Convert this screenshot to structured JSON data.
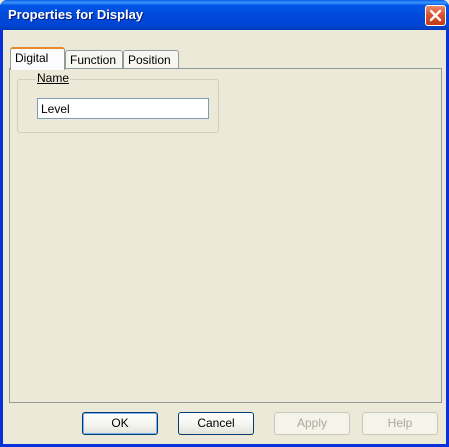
{
  "window": {
    "title": "Properties for Display"
  },
  "tabs": [
    {
      "label": "Digital",
      "active": true
    },
    {
      "label": "Function",
      "active": false
    },
    {
      "label": "Position",
      "active": false
    }
  ],
  "name_group": {
    "label": "Name",
    "value": "Level"
  },
  "buttons": {
    "ok": "OK",
    "cancel": "Cancel",
    "apply": "Apply",
    "help": "Help"
  },
  "colors": {
    "titlebar": "#0054e3",
    "close_button": "#d7532f",
    "dialog_background": "#ece9d8",
    "active_tab_accent": "#e68b2c"
  },
  "icons": {
    "close": "close-icon"
  }
}
